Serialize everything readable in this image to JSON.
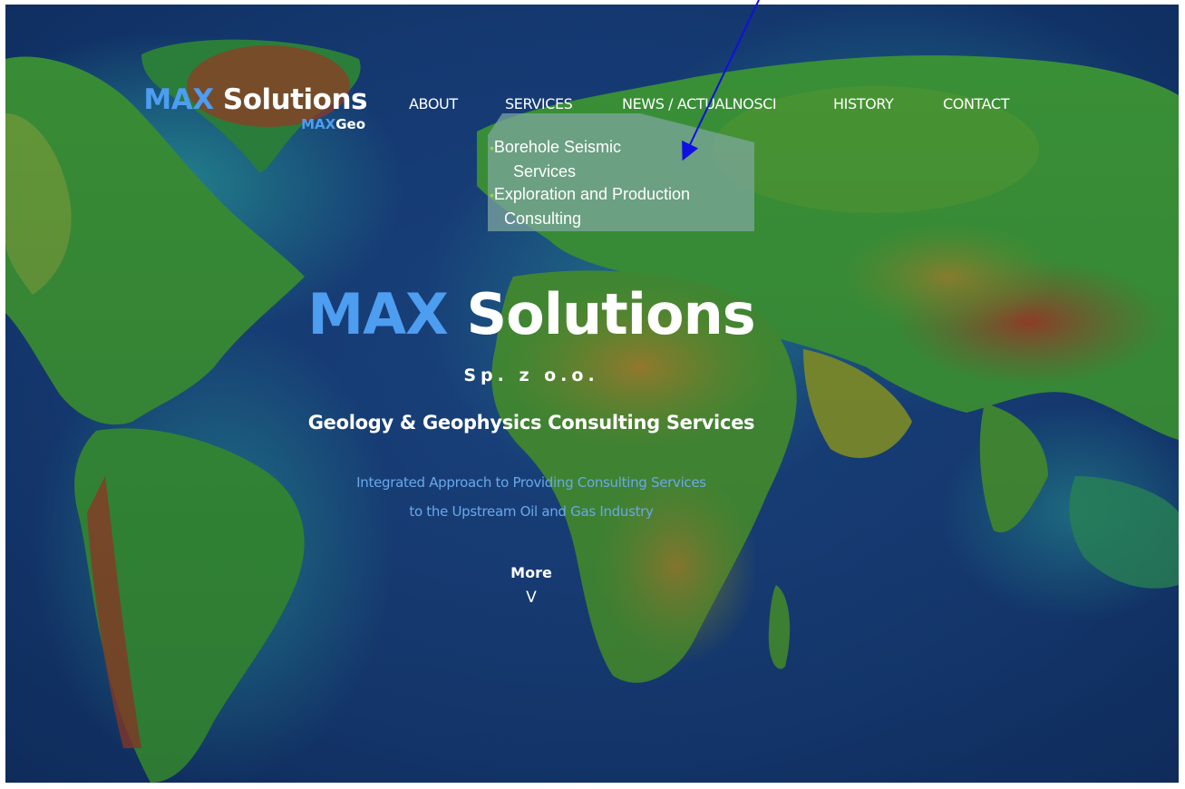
{
  "header": {
    "logo": {
      "max": "MAX",
      "solutions": "Solutions"
    },
    "sublogo": {
      "max": "MAX",
      "geo": "Geo"
    }
  },
  "nav": {
    "items": [
      {
        "label": "ABOUT"
      },
      {
        "label": "SERVICES"
      },
      {
        "label": "NEWS / ACTUALNOSCI"
      },
      {
        "label": "HISTORY"
      },
      {
        "label": "CONTACT"
      }
    ]
  },
  "services_menu": {
    "items": [
      {
        "line1": "Borehole Seismic",
        "line2": "Services"
      },
      {
        "line1": "Exploration and Production",
        "line2": "Consulting"
      }
    ]
  },
  "hero": {
    "title_max": "MAX",
    "title_solutions": "Solutions",
    "legal": "Sp. z o.o.",
    "tagline": "Geology & Geophysics Consulting Services",
    "description_line1": "Integrated Approach to Providing Consulting Services",
    "description_line2": "to the Upstream Oil and Gas Industry",
    "more_label": "More",
    "more_icon": "V"
  },
  "colors": {
    "brand_blue": "#4d9df0",
    "white": "#ffffff",
    "annotation_arrow": "#1010e0"
  },
  "icons": {
    "annotation": "arrow-pointer-icon",
    "bullet": "bullet-icon"
  }
}
